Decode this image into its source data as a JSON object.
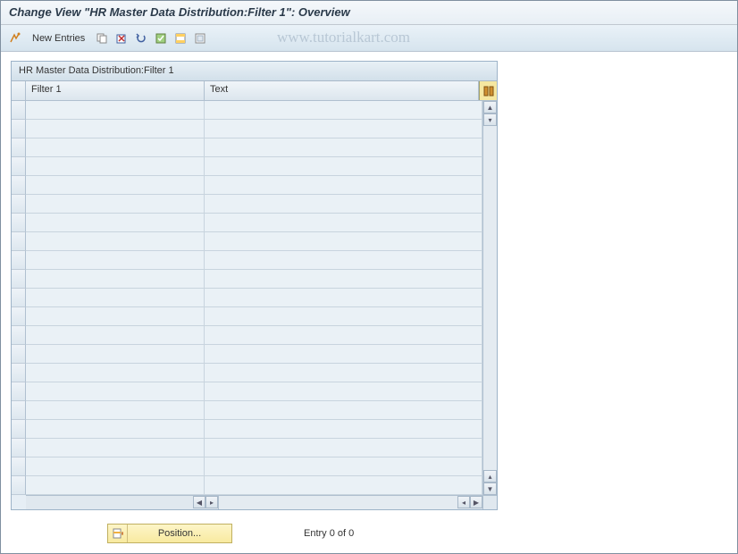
{
  "title": "Change View \"HR Master Data Distribution:Filter 1\": Overview",
  "toolbar": {
    "new_entries_label": "New Entries"
  },
  "watermark": "www.tutorialkart.com",
  "grid": {
    "title": "HR Master Data Distribution:Filter 1",
    "columns": {
      "filter": "Filter 1",
      "text": "Text"
    },
    "row_count": 21
  },
  "footer": {
    "position_label": "Position...",
    "entry_text": "Entry 0 of 0"
  }
}
